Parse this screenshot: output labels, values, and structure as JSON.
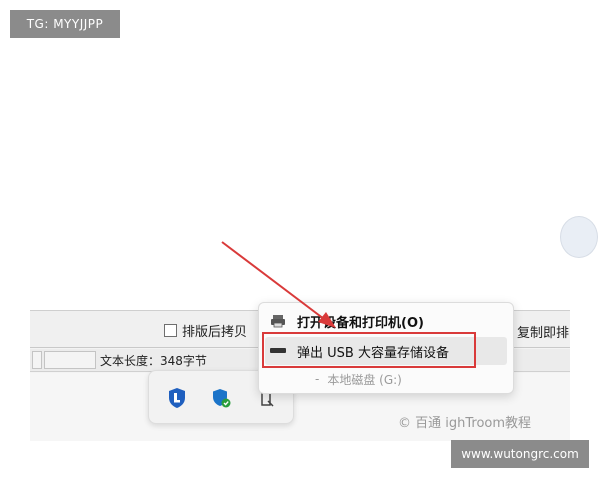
{
  "watermarks": {
    "top_left": "TG: MYYJJPP",
    "bottom_right": "www.wutongrc.com",
    "content": "© 百通 ighTroom教程"
  },
  "toolbar": {
    "checkbox_label": "排版后拷贝",
    "copy_button": "复制即排"
  },
  "statusbar": {
    "text_length": "文本长度：348字节"
  },
  "context_menu": {
    "items": [
      {
        "label": "打开设备和打印机(O)",
        "icon": "printer-icon"
      },
      {
        "label": "弹出 USB 大容量存储设备",
        "icon": "usb-drive-icon"
      },
      {
        "label": "本地磁盘 (G:)",
        "icon": "dash"
      }
    ]
  },
  "tray": {
    "icons": [
      "security-shield-icon",
      "defender-check-icon",
      "usb-eject-icon"
    ]
  },
  "colors": {
    "highlight": "#d93a3a",
    "arrow": "#d93a3a"
  }
}
